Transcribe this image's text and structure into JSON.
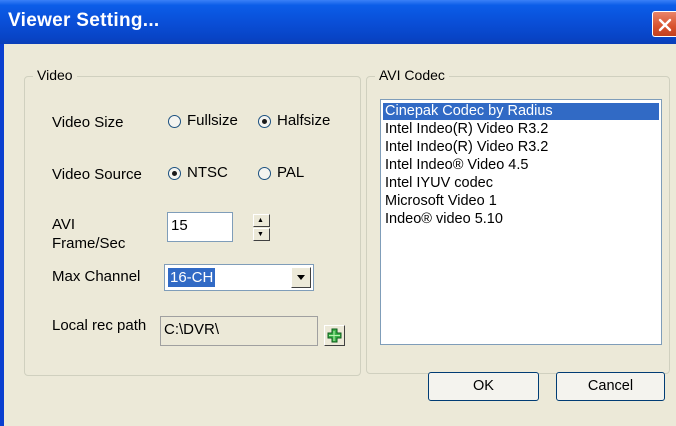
{
  "window": {
    "title": "Viewer Setting..."
  },
  "video_group": {
    "legend": "Video",
    "video_size": {
      "label": "Video Size",
      "options": [
        "Fullsize",
        "Halfsize"
      ],
      "selected": "Halfsize"
    },
    "video_source": {
      "label": "Video Source",
      "options": [
        "NTSC",
        "PAL"
      ],
      "selected": "NTSC"
    },
    "frame_rate": {
      "label_line1": "AVI",
      "label_line2": "Frame/Sec",
      "value": "15"
    },
    "max_channel": {
      "label": "Max Channel",
      "value": "16-CH"
    },
    "local_rec_path": {
      "label": "Local rec path",
      "value": "C:\\DVR\\"
    }
  },
  "codec_group": {
    "legend": "AVI Codec",
    "items": [
      "Cinepak Codec by Radius",
      "Intel Indeo(R) Video R3.2",
      "Intel Indeo(R) Video R3.2",
      "Intel Indeo® Video 4.5",
      "Intel IYUV codec",
      "Microsoft Video 1",
      "Indeo® video 5.10"
    ],
    "selected_index": 0
  },
  "buttons": {
    "ok": "OK",
    "cancel": "Cancel"
  },
  "icons": {
    "close": "close-icon",
    "add": "add-folder-icon"
  },
  "colors": {
    "titlebar": "#0a4fd8",
    "close": "#d8522e",
    "selection": "#316ac5",
    "dialog_bg": "#ece9d8"
  }
}
